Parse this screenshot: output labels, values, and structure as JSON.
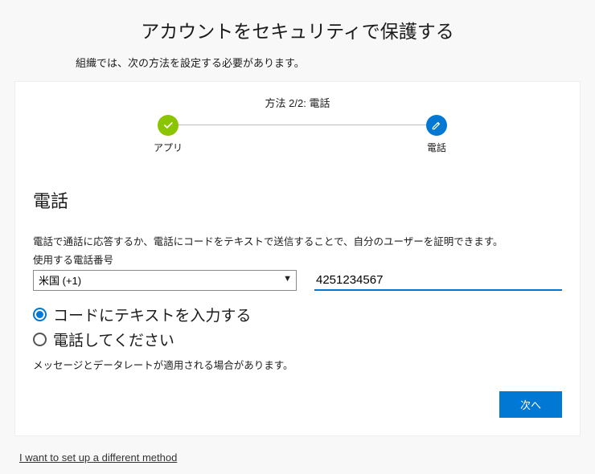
{
  "header": {
    "title": "アカウントをセキュリティで保護する",
    "subtitle": "組織では、次の方法を設定する必要があります。"
  },
  "stepper": {
    "caption": "方法 2/2: 電話",
    "step1_label": "アプリ",
    "step2_label": "電話"
  },
  "phone": {
    "section_title": "電話",
    "description": "電話で通話に応答するか、電話にコードをテキストで送信することで、自分のユーザーを証明できます。",
    "field_label": "使用する電話番号",
    "country_selected": "米国 (+1)",
    "number_value": "4251234567",
    "radio_text_code": "コードにテキストを入力する",
    "radio_call_me": "電話してください",
    "rates_note": "メッセージとデータレートが適用される場合があります。",
    "next_button": "次へ"
  },
  "footer": {
    "alt_method_link": "I want to set up a different method"
  }
}
